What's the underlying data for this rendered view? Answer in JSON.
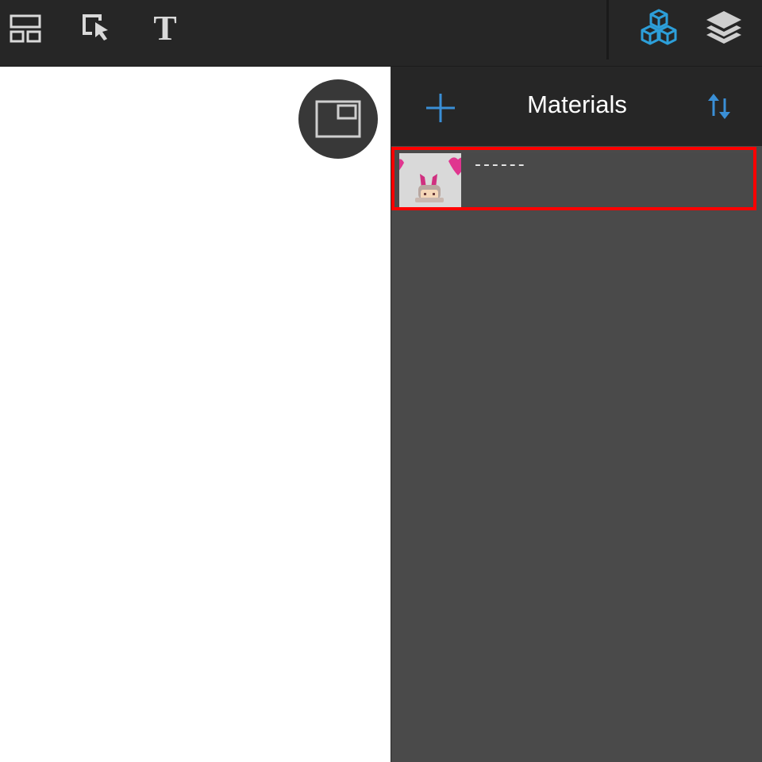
{
  "toolbar": {
    "tools": [
      {
        "icon": "layout-icon"
      },
      {
        "icon": "select-arrow-icon"
      },
      {
        "icon": "text-icon",
        "glyph": "T"
      }
    ],
    "right_tools": [
      {
        "icon": "materials-cubes-icon",
        "active": true,
        "color": "#2d9fd9"
      },
      {
        "icon": "layers-icon",
        "active": false,
        "color": "#cfcfcf"
      }
    ]
  },
  "canvas": {
    "preview_toggle_icon": "picture-in-picture-icon"
  },
  "panel": {
    "title": "Materials",
    "add_icon": "plus-icon",
    "sort_icon": "sort-arrows-icon",
    "accent": "#3a8fd6",
    "items": [
      {
        "name": "------",
        "thumbnail_icon": "character-thumbnail-icon",
        "highlighted": true,
        "highlight_color": "#ff0000"
      }
    ]
  }
}
